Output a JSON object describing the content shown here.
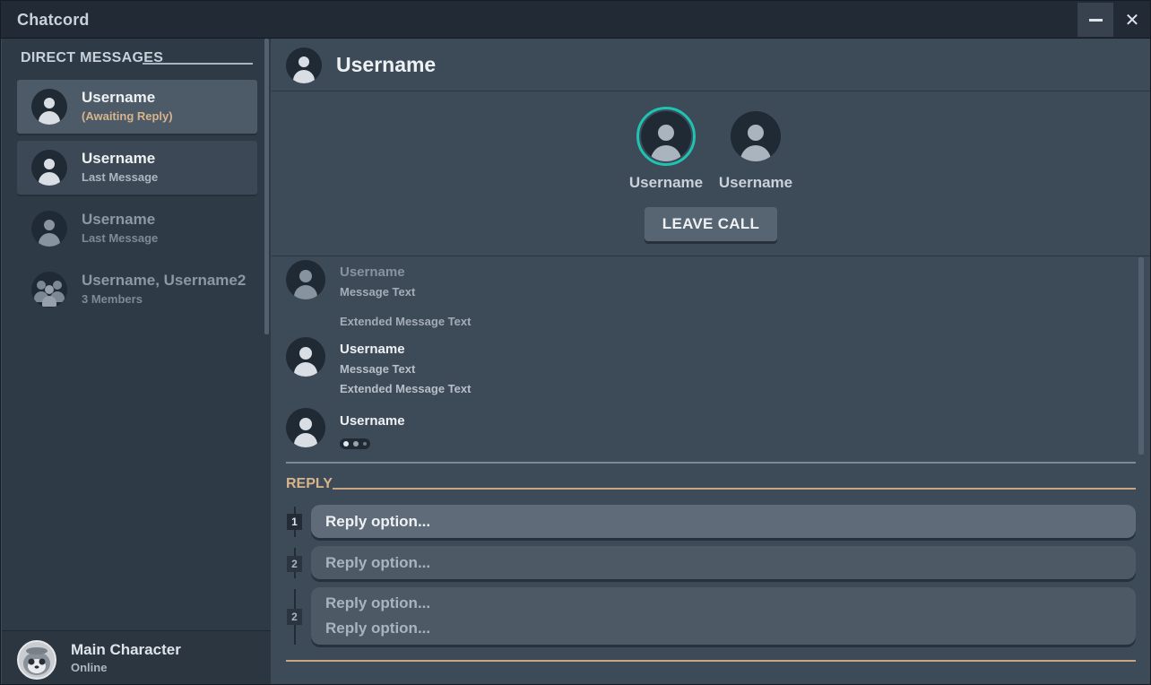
{
  "window": {
    "title": "Chatcord",
    "minimize_icon": "minimize-icon",
    "close_icon": "close-icon",
    "close_glyph": "✕"
  },
  "sidebar": {
    "section_title": "DIRECT MESSAGES",
    "conversations": [
      {
        "name": "Username",
        "subtitle": "(Awaiting Reply)",
        "state": "active"
      },
      {
        "name": "Username",
        "subtitle": "Last Message",
        "state": "normal"
      },
      {
        "name": "Username",
        "subtitle": "Last Message",
        "state": "dim"
      },
      {
        "name": "Username, Username2",
        "subtitle": "3 Members",
        "state": "dim"
      }
    ],
    "current_user": {
      "name": "Main Character",
      "status": "Online"
    }
  },
  "chat": {
    "title": "Username",
    "call": {
      "participants": [
        {
          "name": "Username",
          "speaking": true
        },
        {
          "name": "Username",
          "speaking": false
        }
      ],
      "leave_label": "LEAVE CALL"
    },
    "messages": [
      {
        "author": "Username",
        "lines": [
          "Message Text",
          "Extended Message Text"
        ]
      },
      {
        "author": "Username",
        "lines": [
          "Message Text",
          "Extended Message Text"
        ]
      },
      {
        "author": "Username",
        "typing": true
      }
    ]
  },
  "reply": {
    "title": "REPLY",
    "options": [
      {
        "number": "1",
        "lines": [
          "Reply option..."
        ],
        "selected": true
      },
      {
        "number": "2",
        "lines": [
          "Reply option..."
        ],
        "selected": false
      },
      {
        "number": "2",
        "lines": [
          "Reply option...",
          "Reply option..."
        ],
        "selected": false
      }
    ]
  },
  "colors": {
    "accent_speaking": "#1ec3b1",
    "awaiting_reply": "#d8b48c",
    "reply_accent": "#c9a682"
  }
}
